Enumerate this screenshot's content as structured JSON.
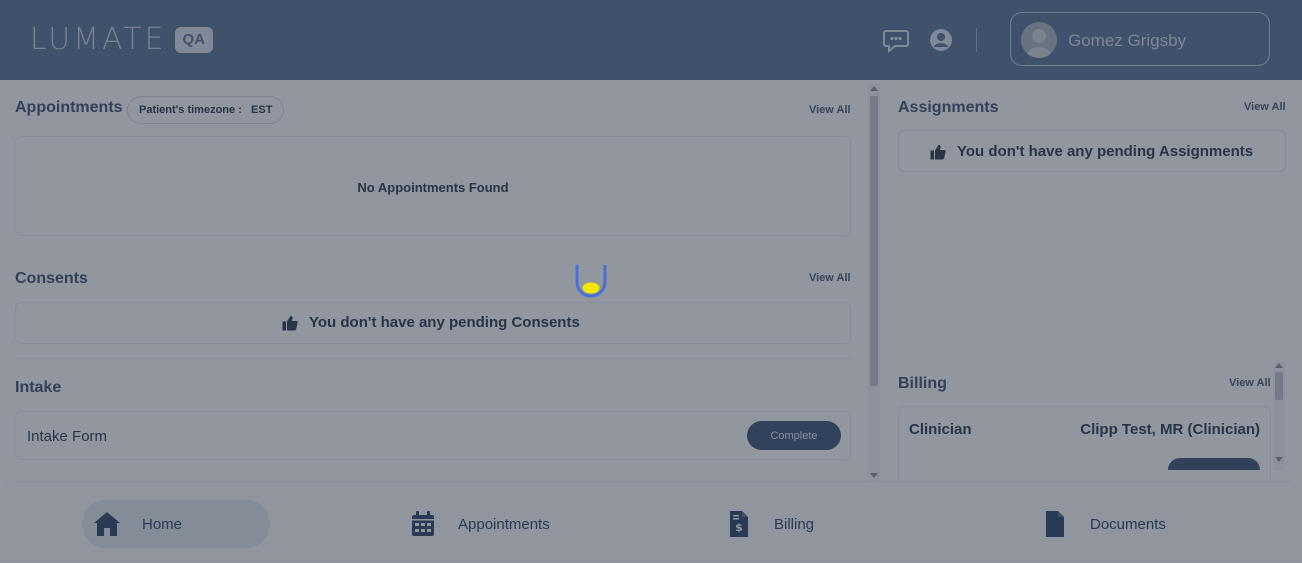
{
  "header": {
    "logo_text": "LUMATE",
    "env_badge": "QA",
    "user_name": "Gomez Grigsby"
  },
  "appointments": {
    "title": "Appointments",
    "timezone_label": "Patient's timezone :",
    "timezone_value": "EST",
    "view_all": "View All",
    "empty_text": "No Appointments Found"
  },
  "consents": {
    "title": "Consents",
    "view_all": "View All",
    "empty_text": "You don't have any pending Consents"
  },
  "intake": {
    "title": "Intake",
    "form_name": "Intake Form",
    "status_button": "Complete"
  },
  "assignments": {
    "title": "Assignments",
    "view_all": "View All",
    "empty_text": "You don't have any pending Assignments"
  },
  "billing": {
    "title": "Billing",
    "view_all": "View All",
    "row_label": "Clinician",
    "row_value": "Clipp Test, MR (Clinician)"
  },
  "bottom_nav": {
    "items": [
      {
        "label": "Home",
        "icon": "home-icon",
        "active": true
      },
      {
        "label": "Appointments",
        "icon": "calendar-icon",
        "active": false
      },
      {
        "label": "Billing",
        "icon": "invoice-dollar-icon",
        "active": false
      },
      {
        "label": "Documents",
        "icon": "document-icon",
        "active": false
      }
    ]
  },
  "colors": {
    "header_bg": "#5b7397",
    "accent": "#3e5579",
    "loader_blue": "#4a6fd6",
    "loader_yellow": "#f5e600"
  }
}
